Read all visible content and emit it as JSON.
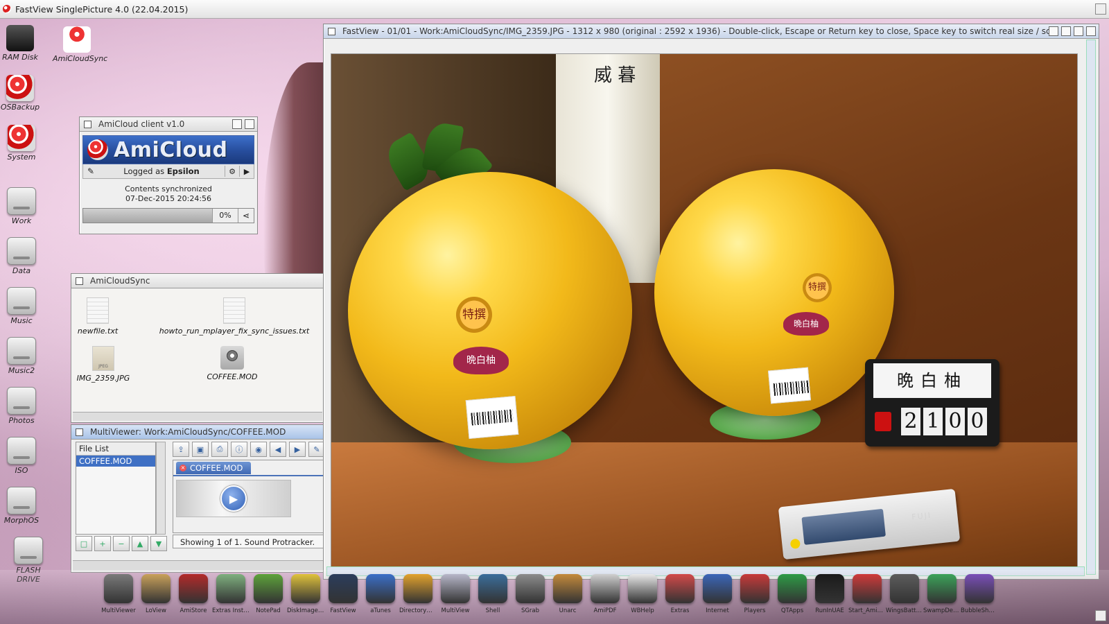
{
  "screen": {
    "title": "FastView SinglePicture 4.0 (22.04.2015)"
  },
  "desktop_icons": [
    {
      "label": "RAM Disk",
      "icon": "ram-disk-icon"
    },
    {
      "label": "AmiCloudSync",
      "icon": "amicloud-icon"
    },
    {
      "label": "OSBackup",
      "icon": "boing-ball-icon"
    },
    {
      "label": "System",
      "icon": "boing-ball-icon"
    },
    {
      "label": "Work",
      "icon": "drive-icon"
    },
    {
      "label": "Data",
      "icon": "drive-icon"
    },
    {
      "label": "Music",
      "icon": "drive-icon"
    },
    {
      "label": "Music2",
      "icon": "drive-icon"
    },
    {
      "label": "Photos",
      "icon": "drive-icon"
    },
    {
      "label": "ISO",
      "icon": "drive-icon"
    },
    {
      "label": "MorphOS",
      "icon": "drive-icon"
    },
    {
      "label": "FLASH DRIVE",
      "icon": "drive-icon"
    }
  ],
  "amicloud": {
    "title": "AmiCloud client v1.0",
    "brand": "AmiCloud",
    "logged_prefix": "Logged as",
    "user": "Epsilon",
    "status_line1": "Contents synchronized",
    "status_line2": "07-Dec-2015 20:24:56",
    "progress_percent": 0,
    "progress_label": "0%"
  },
  "drawer": {
    "title": "AmiCloudSync",
    "files": [
      {
        "name": "newfile.txt",
        "type": "text"
      },
      {
        "name": "howto_run_mplayer_fix_sync_issues.txt",
        "type": "text"
      },
      {
        "name": "IMG_2359.JPG",
        "type": "jpeg"
      },
      {
        "name": "COFFEE.MOD",
        "type": "sound"
      }
    ]
  },
  "multiviewer": {
    "title": "MultiViewer: Work:AmiCloudSync/COFFEE.MOD",
    "file_list_header": "File List",
    "file_list_items": [
      "COFFEE.MOD"
    ],
    "tab_label": "COFFEE.MOD",
    "status": "Showing 1 of 1.  Sound Protracker."
  },
  "fastview": {
    "title": "FastView - 01/01 - Work:AmiCloudSync/IMG_2359.JPG - 1312 x 980 (original : 2592 x 1936) - Double-click, Escape or Return key to close, Space key to switch real size / scaled"
  },
  "photo_text": {
    "pillar_kanji": "威 暮",
    "medal_left": "特撰",
    "medal_right": "特撰",
    "label_left": "晩白柚",
    "label_right": "晩白柚",
    "sign_name": "晩白柚",
    "price_digits": [
      "2",
      "1",
      "0",
      "0"
    ],
    "gadget_brand": "FUJI"
  },
  "dock": [
    "MultiViewer",
    "LoView",
    "AmiStore",
    "Extras Install..",
    "NotePad",
    "DiskImageG..",
    "FastView",
    "aTunes",
    "DirectoryOp..",
    "MultiView",
    "Shell",
    "SGrab",
    "Unarc",
    "AmiPDF",
    "WBHelp",
    "Extras",
    "Internet",
    "Players",
    "QTApps",
    "RunInUAE",
    "Start_AmiCygnix.b..",
    "WingsBattlefield.in..",
    "SwampDefe..",
    "BubbleShoo.."
  ],
  "colors": {
    "accent": "#3f70c4",
    "amicloud_blue": "#274d9c"
  }
}
